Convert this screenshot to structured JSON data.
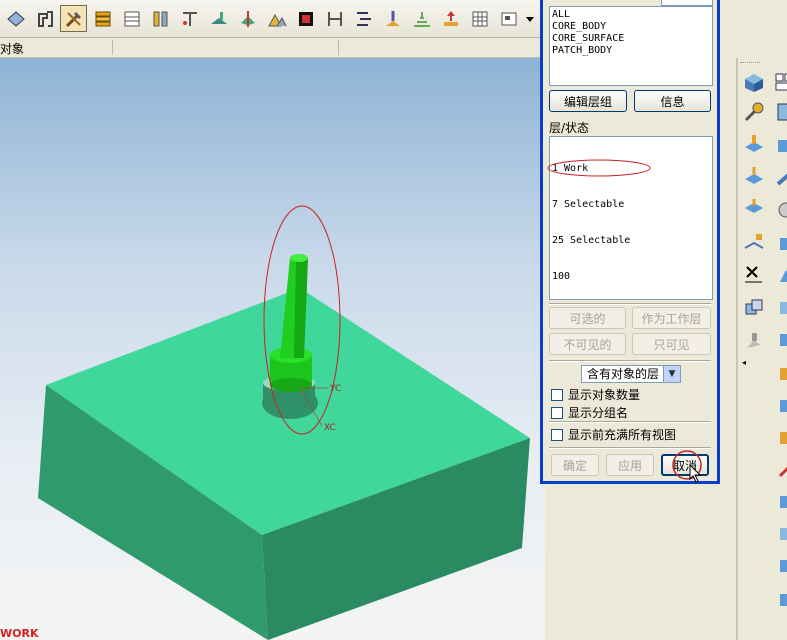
{
  "toolbar": {
    "icons": [
      "sheet-metal-icon",
      "rotate-icon",
      "tools-icon",
      "gear-stack-icon",
      "window-icon",
      "ruler-icon",
      "text-t-icon",
      "plane-icon",
      "cut-icon",
      "flag-icon",
      "measure-icon",
      "align-icon",
      "bars-icon",
      "drill-icon",
      "stack-icon",
      "move-icon",
      "grid-icon",
      "view-icon",
      "dropdown-arrow-icon"
    ]
  },
  "subbar": {
    "label": "对象"
  },
  "viewport": {
    "work_label": "WORK",
    "yc_label": "YC",
    "xc_label": "XC"
  },
  "dialog": {
    "categories": [
      "ALL",
      "CORE_BODY",
      "CORE_SURFACE",
      "PATCH_BODY"
    ],
    "edit_group_button": "编辑层组",
    "info_button": "信息",
    "layer_status_label": "层/状态",
    "layers": [
      "  1 Work",
      "  7 Selectable",
      " 25 Selectable",
      "100"
    ],
    "btn_selectable": "可选的",
    "btn_make_work": "作为工作层",
    "btn_invisible": "不可见的",
    "btn_visible_only": "只可见",
    "filter_select": "含有对象的层",
    "chk_show_count": "显示对象数量",
    "chk_show_group": "显示分组名",
    "chk_fit_views": "显示前充满所有视图",
    "btn_ok": "确定",
    "btn_apply": "应用",
    "btn_cancel": "取消"
  },
  "colors": {
    "dialog_border": "#0a3ec8",
    "model_green": "#2e9e70",
    "highlight_red": "#cc2222"
  }
}
